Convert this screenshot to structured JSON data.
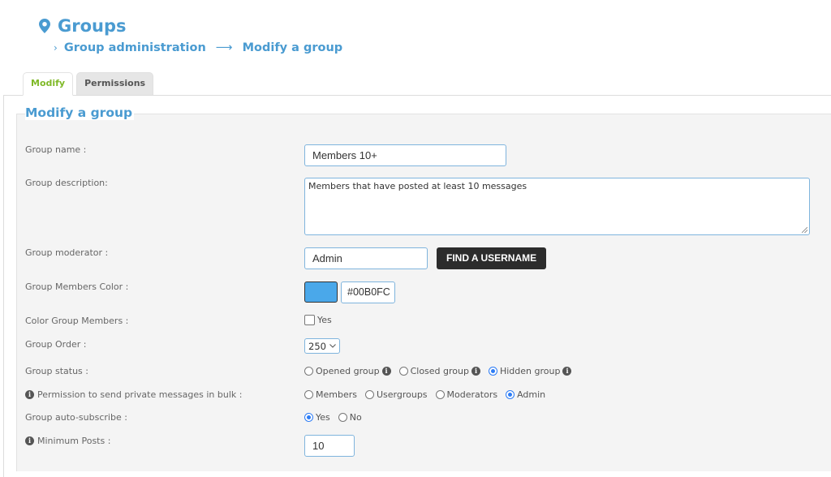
{
  "header": {
    "title": "Groups",
    "breadcrumb": [
      {
        "label": "Group administration"
      },
      {
        "label": "Modify a group"
      }
    ]
  },
  "tabs": [
    {
      "label": "Modify",
      "active": true
    },
    {
      "label": "Permissions",
      "active": false
    }
  ],
  "form": {
    "legend": "Modify a group",
    "group_name": {
      "label": "Group name :",
      "value": "Members 10+"
    },
    "group_description": {
      "label": "Group description:",
      "value": "Members that have posted at least 10 messages"
    },
    "group_moderator": {
      "label": "Group moderator :",
      "value": "Admin",
      "button": "FIND A USERNAME"
    },
    "members_color": {
      "label": "Group Members Color :",
      "value": "#00B0FC",
      "swatch": "#4aa8ea"
    },
    "color_group_members": {
      "label": "Color Group Members :",
      "option": "Yes",
      "checked": false
    },
    "group_order": {
      "label": "Group Order :",
      "value": "250"
    },
    "group_status": {
      "label": "Group status :",
      "options": [
        {
          "label": "Opened group",
          "checked": false
        },
        {
          "label": "Closed group",
          "checked": false
        },
        {
          "label": "Hidden group",
          "checked": true
        }
      ]
    },
    "bulk_pm": {
      "label": "Permission to send private messages in bulk :",
      "options": [
        {
          "label": "Members",
          "checked": false
        },
        {
          "label": "Usergroups",
          "checked": false
        },
        {
          "label": "Moderators",
          "checked": false
        },
        {
          "label": "Admin",
          "checked": true
        }
      ]
    },
    "auto_subscribe": {
      "label": "Group auto-subscribe :",
      "options": [
        {
          "label": "Yes",
          "checked": true
        },
        {
          "label": "No",
          "checked": false
        }
      ]
    },
    "minimum_posts": {
      "label": "Minimum Posts :",
      "value": "10"
    }
  },
  "colors": {
    "accent": "#4a9bd1",
    "active_tab": "#7fb927",
    "radio": "#2d7cf5"
  }
}
